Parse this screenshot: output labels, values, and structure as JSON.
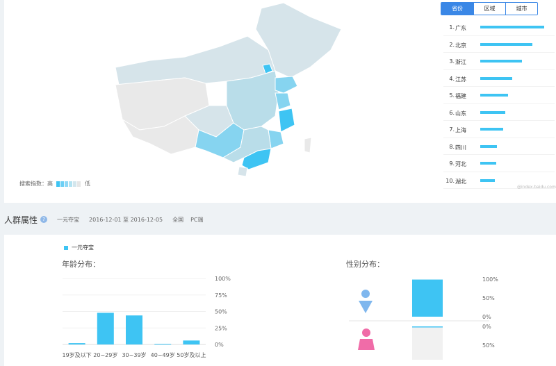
{
  "map": {
    "legend_label": "搜索指数：高",
    "legend_low": "低",
    "legend_colors": [
      "#3ec4f3",
      "#6ccff5",
      "#8fd8f6",
      "#b3e3f2",
      "#d3e6ed",
      "#e6e6e6"
    ],
    "region_colors": {
      "top": "#3ec4f3",
      "high": "#86d4f0",
      "mid": "#b9dde9",
      "low": "#d6e4ea",
      "none": "#e9e9e9"
    }
  },
  "tabs": [
    {
      "label": "省份",
      "active": true
    },
    {
      "label": "区域",
      "active": false
    },
    {
      "label": "城市",
      "active": false
    }
  ],
  "ranking": [
    {
      "rank": "1.",
      "name": "广东",
      "value": 1.0
    },
    {
      "rank": "2.",
      "name": "北京",
      "value": 0.82
    },
    {
      "rank": "3.",
      "name": "浙江",
      "value": 0.65
    },
    {
      "rank": "4.",
      "name": "江苏",
      "value": 0.5
    },
    {
      "rank": "5.",
      "name": "福建",
      "value": 0.43
    },
    {
      "rank": "6.",
      "name": "山东",
      "value": 0.39
    },
    {
      "rank": "7.",
      "name": "上海",
      "value": 0.36
    },
    {
      "rank": "8.",
      "name": "四川",
      "value": 0.26
    },
    {
      "rank": "9.",
      "name": "河北",
      "value": 0.25
    },
    {
      "rank": "10.",
      "name": "湖北",
      "value": 0.23
    }
  ],
  "watermark": "@index.baidu.com",
  "crowd": {
    "title": "人群属性",
    "help": "?",
    "keyword": "一元夺宝",
    "date_range": "2016-12-01 至 2016-12-05",
    "region": "全国",
    "platform": "PC端"
  },
  "series_legend": "一元夺宝",
  "chart_data": [
    {
      "type": "bar",
      "title": "年龄分布：",
      "categories": [
        "19岁及以下",
        "20~29岁",
        "30~39岁",
        "40~49岁",
        "50岁及以上"
      ],
      "series": [
        {
          "values": [
            2,
            48,
            44,
            1,
            6
          ]
        }
      ],
      "ylim": [
        0,
        100
      ],
      "yticks": [
        "0%",
        "25%",
        "50%",
        "75%",
        "100%"
      ],
      "color": "#3ec4f3"
    },
    {
      "type": "bar",
      "title": "性别分布：",
      "categories": [
        "male",
        "female"
      ],
      "series": [
        {
          "values": [
            99,
            1
          ]
        }
      ],
      "ylim": [
        0,
        100
      ],
      "male_ticks": [
        "100%",
        "50%",
        "0%"
      ],
      "female_ticks": [
        "0%",
        "50%"
      ],
      "colors": {
        "male": "#3ec4f3",
        "female": "#3ec4f3",
        "male_icon": "#7fb7ee",
        "female_icon": "#f06ca8",
        "track": "#f1f1f1"
      }
    }
  ]
}
